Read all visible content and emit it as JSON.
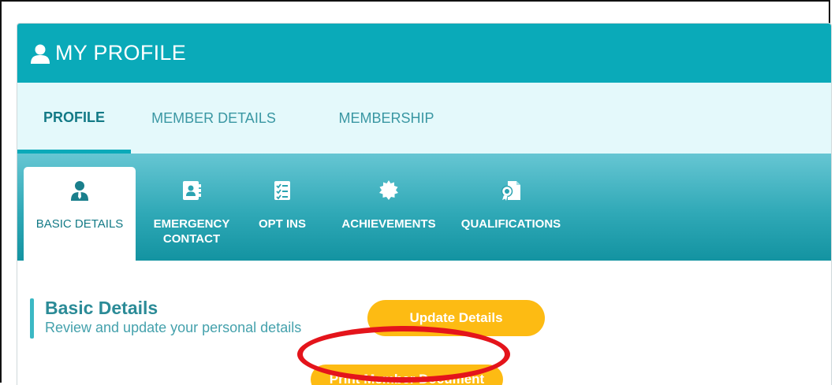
{
  "header": {
    "title": "MY PROFILE",
    "icon": "user-icon",
    "background": "#0aaab9"
  },
  "top_tabs": [
    {
      "label": "PROFILE",
      "active": true
    },
    {
      "label": "MEMBER DETAILS",
      "active": false
    },
    {
      "label": "MEMBERSHIP",
      "active": false
    }
  ],
  "sub_tabs": [
    {
      "label_line1": "BASIC DETAILS",
      "label_line2": "",
      "icon": "user-tie-icon",
      "active": true
    },
    {
      "label_line1": "EMERGENCY",
      "label_line2": "CONTACT",
      "icon": "address-book-icon",
      "active": false
    },
    {
      "label_line1": "OPT INS",
      "label_line2": "",
      "icon": "checklist-icon",
      "active": false
    },
    {
      "label_line1": "ACHIEVEMENTS",
      "label_line2": "",
      "icon": "badge-icon",
      "active": false
    },
    {
      "label_line1": "QUALIFICATIONS",
      "label_line2": "",
      "icon": "certificate-icon",
      "active": false
    }
  ],
  "section": {
    "title": "Basic Details",
    "subtitle": "Review and update your personal details"
  },
  "buttons": {
    "update_label": "Update Details",
    "print_label": "Print Member Document",
    "color": "#fdbb13"
  },
  "annotation": {
    "highlight_color": "#e4141b"
  }
}
